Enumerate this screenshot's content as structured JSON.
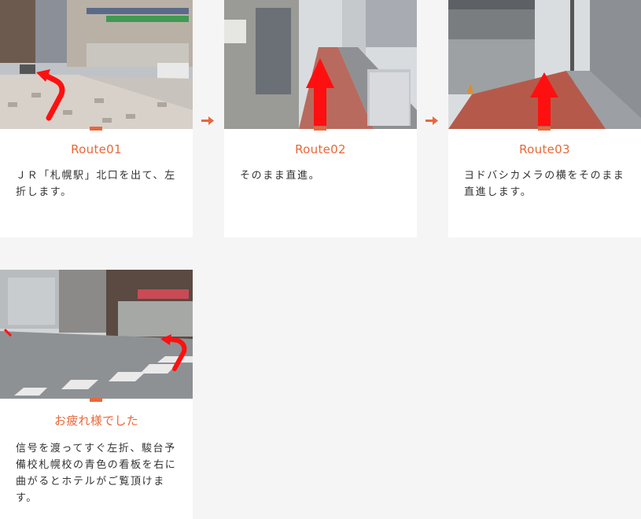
{
  "route_steps": [
    {
      "title": "Route01",
      "description": "ＪＲ「札幌駅」北口を出て、左折します。",
      "photo_alt": "street-corner-photo"
    },
    {
      "title": "Route02",
      "description": "そのまま直進。",
      "photo_alt": "sidewalk-straight-photo"
    },
    {
      "title": "Route03",
      "description": "ヨドバシカメラの横をそのまま直進します。",
      "photo_alt": "brick-sidewalk-photo"
    },
    {
      "title": "お疲れ様でした",
      "description": "信号を渡ってすぐ左折、駿台予備校札幌校の青色の看板を右に曲がるとホテルがご覧頂けます。",
      "photo_alt": "crosswalk-photo"
    }
  ],
  "colors": {
    "accent": "#e8683a",
    "guide_arrow": "#ff1010",
    "background": "#f5f5f5"
  },
  "icons": {
    "step_connector": "right-arrow-icon",
    "guide": "red-direction-arrow-icon"
  }
}
